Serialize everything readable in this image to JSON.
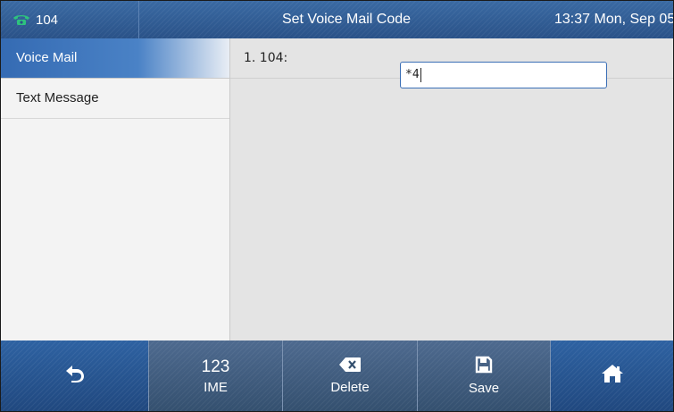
{
  "header": {
    "account_number": "104",
    "title": "Set Voice Mail Code",
    "datetime": "13:37 Mon, Sep 05"
  },
  "sidebar": {
    "items": [
      {
        "label": "Voice Mail",
        "active": true
      },
      {
        "label": "Text Message",
        "active": false
      }
    ]
  },
  "content": {
    "row_label": "1. 104:",
    "code_value": "*4"
  },
  "softkeys": {
    "back_icon": "back-arrow-icon",
    "ime_top": "123",
    "ime_label": "IME",
    "delete_icon": "backspace-icon",
    "delete_label": "Delete",
    "save_icon": "floppy-disk-icon",
    "save_label": "Save",
    "home_icon": "home-icon"
  },
  "colors": {
    "header_blue": "#3a6aa3",
    "active_item_blue": "#356bb3",
    "softkey_blue": "#2e62a2",
    "phone_icon_green": "#2ec27e"
  }
}
